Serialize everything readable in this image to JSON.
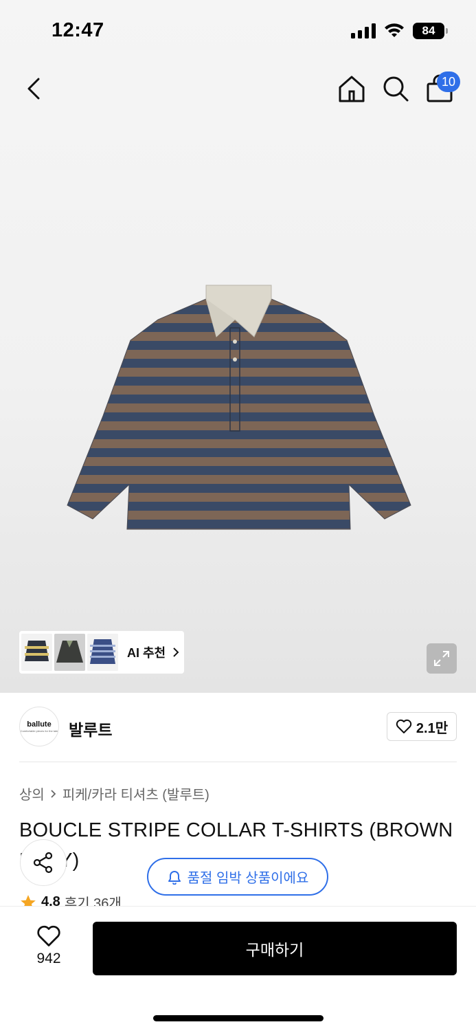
{
  "status_bar": {
    "time": "12:47",
    "battery": "84"
  },
  "nav": {
    "cart_count": "10"
  },
  "ai_recommend": {
    "label": "AI 추천"
  },
  "brand": {
    "logo_text": "ballute",
    "logo_sub": "Comfortable pieces for the tale",
    "name": "발루트",
    "likes": "2.1만"
  },
  "breadcrumb": {
    "category": "상의",
    "subcategory": "피케/카라 티셔츠 (발루트)"
  },
  "product": {
    "title": "BOUCLE STRIPE COLLAR T-SHIRTS (BROWN NAVY)"
  },
  "stock_notice": {
    "text": "품절 임박 상품이에요"
  },
  "rating": {
    "score": "4.8",
    "reviews": "후기 36개"
  },
  "bottom": {
    "like_count": "942",
    "buy_label": "구매하기"
  },
  "colors": {
    "accent": "#2f6fe8",
    "stripe_brown": "#7d6656",
    "stripe_navy": "#3a4a66",
    "collar": "#dcd8cc"
  }
}
